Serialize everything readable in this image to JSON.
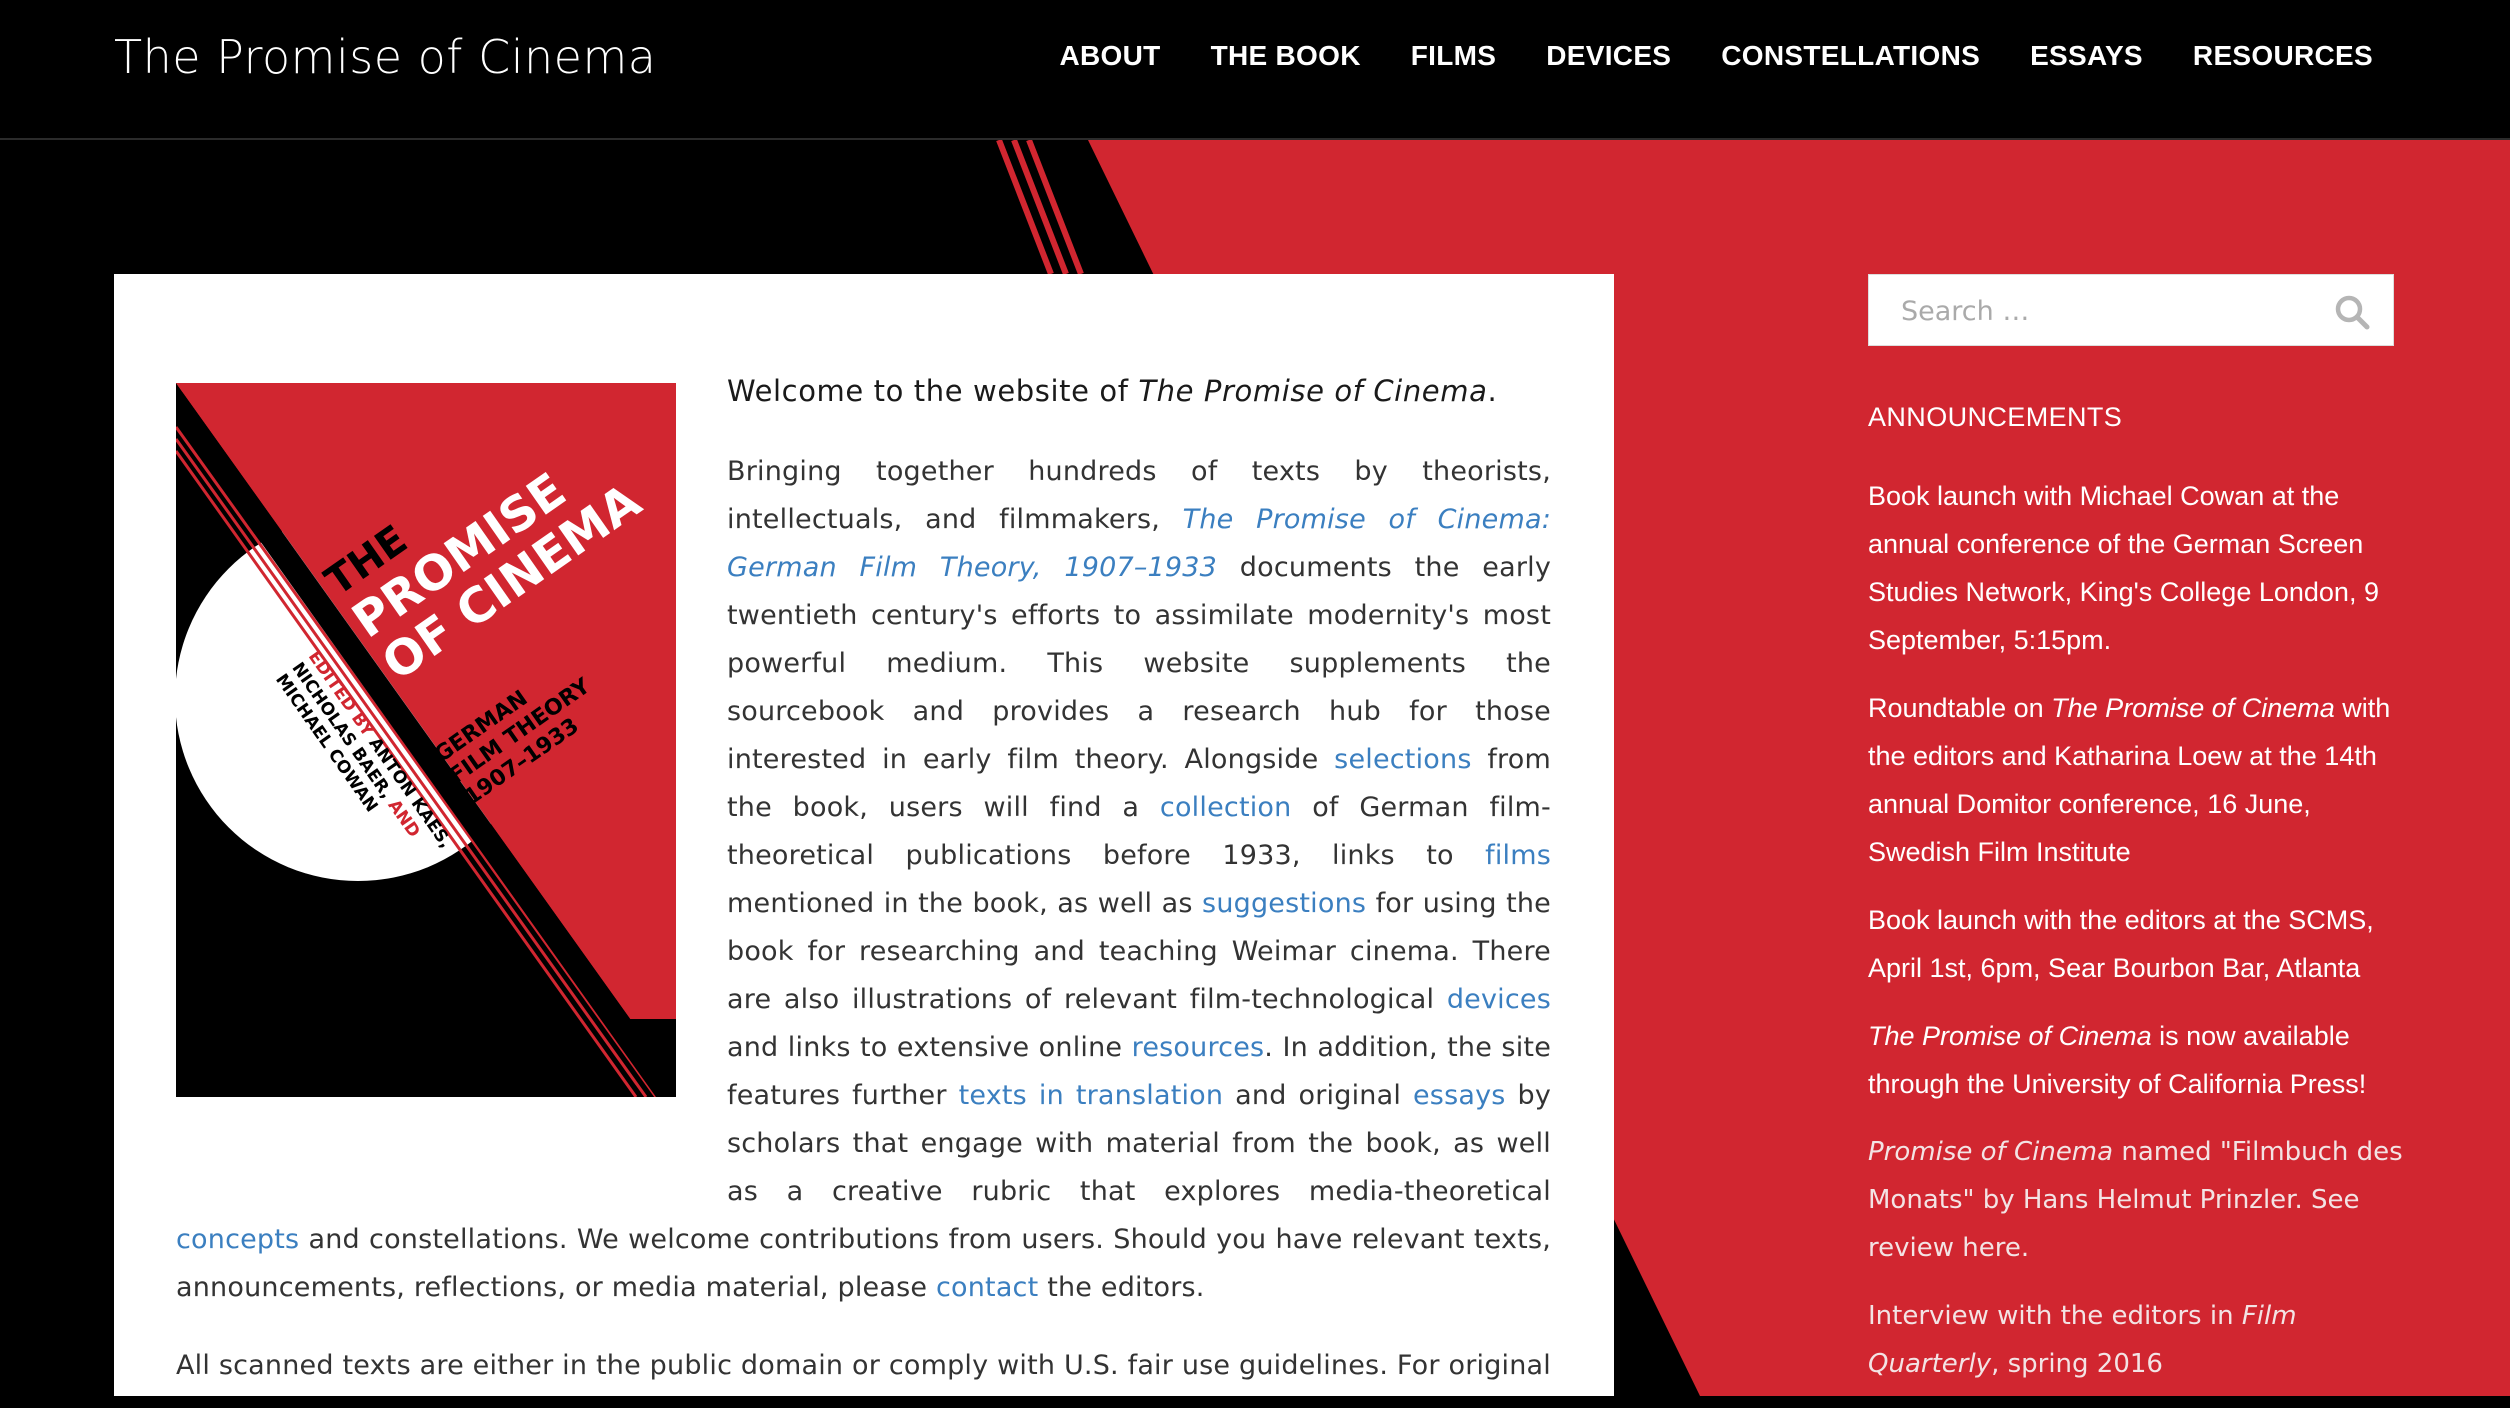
{
  "site": {
    "title": "The Promise of Cinema"
  },
  "nav": {
    "items": [
      {
        "label": "ABOUT"
      },
      {
        "label": "THE BOOK"
      },
      {
        "label": "FILMS"
      },
      {
        "label": "DEVICES"
      },
      {
        "label": "CONSTELLATIONS"
      },
      {
        "label": "ESSAYS"
      },
      {
        "label": "RESOURCES"
      }
    ]
  },
  "colors": {
    "brand_red": "#d12630",
    "background_black": "#000000",
    "link_blue": "#3b7fc0"
  },
  "cover": {
    "title_line1": "THE",
    "title_line2": "PROMISE",
    "title_line3": "OF CINEMA",
    "subtitle_line1": "GERMAN",
    "subtitle_line2": "FILM THEORY",
    "subtitle_line3": "1907–1933",
    "editors_prefix": "EDITED BY",
    "editors_line1": "ANTON KAES,",
    "editors_line2": "NICHOLAS BAER,",
    "editors_and": "AND",
    "editors_line3": "MICHAEL COWAN"
  },
  "main": {
    "welcome_prefix": "Welcome to the website of ",
    "welcome_title": "The Promise of Cinema",
    "welcome_suffix": ".",
    "p1": {
      "t1": "Bringing together hundreds of texts by theorists, intellectuals, and filmmakers, ",
      "book_link": "The Promise of Cinema: German Film Theory, 1907–1933",
      "t2": " documents the early twentieth century's efforts to assimilate modernity's most powerful medium. This website supplements the sourcebook and provides a research hub for those interested in early film theory. Alongside ",
      "selections_link": "selections",
      "t3": " from the book, users will find a ",
      "collection_link": "collection",
      "t4": " of German film-theoretical publications before 1933, links to ",
      "films_link": "films",
      "t5": " mentioned in the book, as well as ",
      "suggestions_link": "suggestions",
      "t6": " for using the book for researching and teaching Weimar cinema. There are also illustrations of relevant film-technological ",
      "devices_link": "devices",
      "t7": " and links to extensive online ",
      "resources_link": "resources",
      "t8": ". In addition, the site features further ",
      "translation_link": "texts in translation",
      "t9": " and original ",
      "essays_link": "essays",
      "t10": " by scholars that engage with material from the book, as well as a creative rubric that explores media-theoretical ",
      "concepts_link": "concepts",
      "t11": " and constellations. We welcome contributions from users. Should you have relevant texts, announcements, reflections, or media material, please ",
      "contact_link": "contact",
      "t12": " the editors."
    },
    "p2": "All scanned texts are either in the public domain or comply with U.S. fair use guidelines. For original scholarly essays and translations, the copyright rests with the authors."
  },
  "sidebar": {
    "search": {
      "placeholder": "Search …"
    },
    "heading": "ANNOUNCEMENTS",
    "a1": "Book launch with Michael Cowan at the annual conference of the German Screen Studies Network, King's College London, 9 September, 5:15pm.",
    "a2_prefix": "Roundtable on ",
    "a2_title": "The Promise of Cinema",
    "a2_suffix": " with the editors and Katharina Loew at the 14th annual Domitor conference, 16 June, Swedish Film Institute",
    "a3": "Book launch with the editors at the SCMS, April 1st, 6pm, Sear Bourbon Bar, Atlanta",
    "a4_title": "The Promise of Cinema",
    "a4_suffix": " is now available through the University of California Press!",
    "a5_title": "Promise of Cinema",
    "a5_suffix": " named \"Filmbuch des Monats\" by Hans Helmut Prinzler. See review here.",
    "a6_prefix": "Interview with the editors in ",
    "a6_title": "Film Quarterly",
    "a6_suffix": ", spring 2016"
  }
}
